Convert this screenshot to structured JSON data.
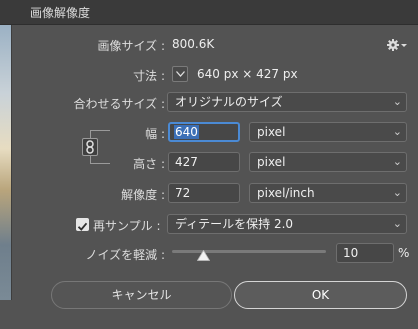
{
  "window": {
    "title": "画像解像度"
  },
  "image_size": {
    "label": "画像サイズ :",
    "value": "800.6K"
  },
  "dimensions": {
    "label": "寸法 :",
    "value": "640 px × 427 px"
  },
  "fit_to": {
    "label": "合わせるサイズ :",
    "value": "オリジナルのサイズ"
  },
  "width": {
    "label": "幅 :",
    "value": "640",
    "unit": "pixel"
  },
  "height": {
    "label": "高さ :",
    "value": "427",
    "unit": "pixel"
  },
  "resolution": {
    "label": "解像度 :",
    "value": "72",
    "unit": "pixel/inch"
  },
  "resample": {
    "label": "再サンプル :",
    "checked": true,
    "method": "ディテールを保持 2.0"
  },
  "noise": {
    "label": "ノイズを軽減 :",
    "value": "10",
    "unit": "%",
    "level": 0.2
  },
  "buttons": {
    "cancel": "キャンセル",
    "ok": "OK"
  },
  "icons": [
    "gear-icon",
    "chevron-down-icon",
    "link-icon",
    "checkmark-icon",
    "slider-thumb-icon"
  ],
  "colors": {
    "accent": "#4b8ad4",
    "selection": "#3b6fb6",
    "background": "#535353"
  }
}
